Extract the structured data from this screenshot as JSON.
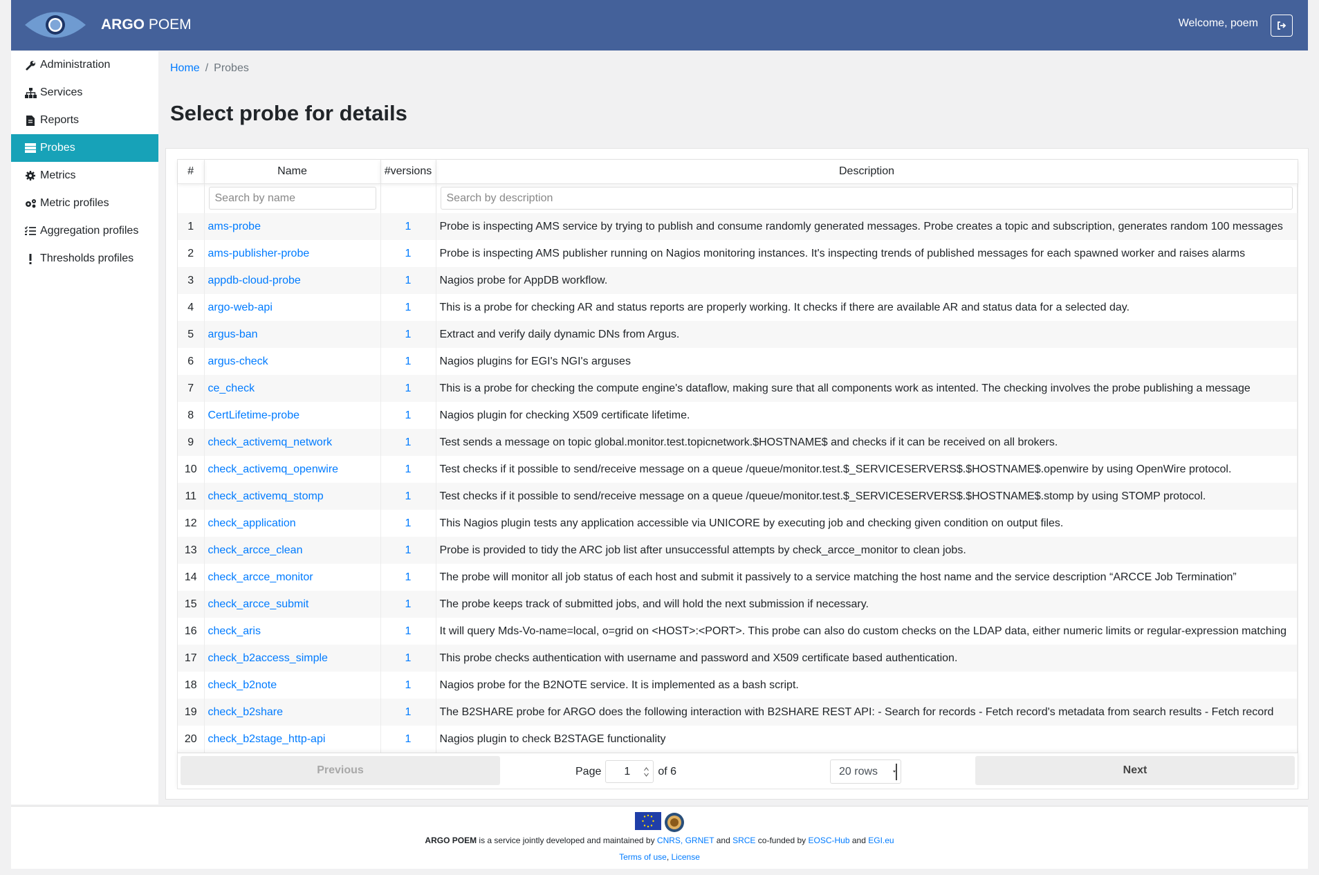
{
  "header": {
    "brand_bold": "ARGO",
    "brand_rest": " POEM",
    "welcome": "Welcome, poem"
  },
  "sidebar": {
    "items": [
      {
        "label": "Administration",
        "icon": "wrench-icon"
      },
      {
        "label": "Services",
        "icon": "sitemap-icon"
      },
      {
        "label": "Reports",
        "icon": "file-icon"
      },
      {
        "label": "Probes",
        "icon": "server-icon",
        "active": true
      },
      {
        "label": "Metrics",
        "icon": "cog-icon"
      },
      {
        "label": "Metric profiles",
        "icon": "cogs-icon"
      },
      {
        "label": "Aggregation profiles",
        "icon": "tasks-icon"
      },
      {
        "label": "Thresholds profiles",
        "icon": "exclamation-icon"
      }
    ]
  },
  "breadcrumb": {
    "home": "Home",
    "current": "Probes"
  },
  "page_title": "Select probe for details",
  "table": {
    "headers": [
      "#",
      "Name",
      "#versions",
      "Description"
    ],
    "name_placeholder": "Search by name",
    "description_placeholder": "Search by description",
    "rows": [
      {
        "n": "1",
        "name": "ams-probe",
        "versions": "1",
        "desc": "Probe is inspecting AMS service by trying to publish and consume randomly generated messages. Probe creates a topic and subscription, generates random 100 messages"
      },
      {
        "n": "2",
        "name": "ams-publisher-probe",
        "versions": "1",
        "desc": "Probe is inspecting AMS publisher running on Nagios monitoring instances. It's inspecting trends of published messages for each spawned worker and raises alarms"
      },
      {
        "n": "3",
        "name": "appdb-cloud-probe",
        "versions": "1",
        "desc": "Nagios probe for AppDB workflow."
      },
      {
        "n": "4",
        "name": "argo-web-api",
        "versions": "1",
        "desc": "This is a probe for checking AR and status reports are properly working. It checks if there are available AR and status data for a selected day."
      },
      {
        "n": "5",
        "name": "argus-ban",
        "versions": "1",
        "desc": "Extract and verify daily dynamic DNs from Argus."
      },
      {
        "n": "6",
        "name": "argus-check",
        "versions": "1",
        "desc": "Nagios plugins for EGI's NGI's arguses"
      },
      {
        "n": "7",
        "name": "ce_check",
        "versions": "1",
        "desc": "This is a probe for checking the compute engine's dataflow, making sure that all components work as intented. The checking involves the probe publishing a message"
      },
      {
        "n": "8",
        "name": "CertLifetime-probe",
        "versions": "1",
        "desc": "Nagios plugin for checking X509 certificate lifetime."
      },
      {
        "n": "9",
        "name": "check_activemq_network",
        "versions": "1",
        "desc": "Test sends a message on topic global.monitor.test.topicnetwork.$HOSTNAME$ and checks if it can be received on all brokers."
      },
      {
        "n": "10",
        "name": "check_activemq_openwire",
        "versions": "1",
        "desc": "Test checks if it possible to send/receive message on a queue /queue/monitor.test.$_SERVICESERVERS$.$HOSTNAME$.openwire by using OpenWire protocol."
      },
      {
        "n": "11",
        "name": "check_activemq_stomp",
        "versions": "1",
        "desc": "Test checks if it possible to send/receive message on a queue /queue/monitor.test.$_SERVICESERVERS$.$HOSTNAME$.stomp by using STOMP protocol."
      },
      {
        "n": "12",
        "name": "check_application",
        "versions": "1",
        "desc": "This Nagios plugin tests any application accessible via UNICORE by executing job and checking given condition on output files."
      },
      {
        "n": "13",
        "name": "check_arcce_clean",
        "versions": "1",
        "desc": "Probe is provided to tidy the ARC job list after unsuccessful attempts by check_arcce_monitor to clean jobs."
      },
      {
        "n": "14",
        "name": "check_arcce_monitor",
        "versions": "1",
        "desc": "The probe will monitor all job status of each host and submit it passively to a service matching the host name and the service description “ARCCE Job Termination”"
      },
      {
        "n": "15",
        "name": "check_arcce_submit",
        "versions": "1",
        "desc": "The probe keeps track of submitted jobs, and will hold the next submission if necessary."
      },
      {
        "n": "16",
        "name": "check_aris",
        "versions": "1",
        "desc": "It will query Mds-Vo-name=local, o=grid on <HOST>:<PORT>. This probe can also do custom checks on the LDAP data, either numeric limits or regular-expression matching"
      },
      {
        "n": "17",
        "name": "check_b2access_simple",
        "versions": "1",
        "desc": "This probe checks authentication with username and password and X509 certificate based authentication."
      },
      {
        "n": "18",
        "name": "check_b2note",
        "versions": "1",
        "desc": "Nagios probe for the B2NOTE service. It is implemented as a bash script."
      },
      {
        "n": "19",
        "name": "check_b2share",
        "versions": "1",
        "desc": "The B2SHARE probe for ARGO does the following interaction with B2SHARE REST API: - Search for records - Fetch record's metadata from search results - Fetch record"
      },
      {
        "n": "20",
        "name": "check_b2stage_http-api",
        "versions": "1",
        "desc": "Nagios plugin to check B2STAGE functionality"
      }
    ]
  },
  "pagination": {
    "previous": "Previous",
    "next": "Next",
    "page_label": "Page",
    "page_value": "1",
    "of_label": "of 6",
    "rows_option": "20 rows"
  },
  "footer": {
    "brand": "ARGO POEM",
    "text1": " is a service jointly developed and maintained by ",
    "cnrs": "CNRS,",
    "grnet": "GRNET",
    "and1": " and ",
    "srce": "SRCE",
    "cofunded": " co-funded by ",
    "eosc": "EOSC-Hub",
    "and2": " and ",
    "egi": "EGI.eu",
    "terms": "Terms of use",
    "comma": ", ",
    "license": "License"
  },
  "colors": {
    "header": "#44619a",
    "active": "#17a2b8",
    "link": "#007bff"
  }
}
